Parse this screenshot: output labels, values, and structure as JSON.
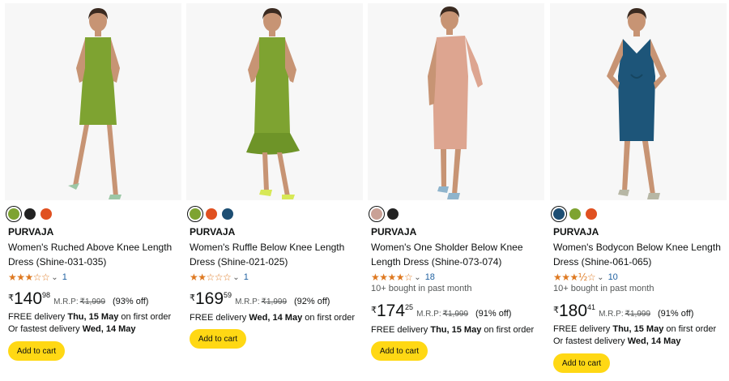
{
  "colors": {
    "star": "#de7921",
    "link": "#2162a1",
    "cart_button": "#ffd814",
    "card_bg": "#f7f7f7"
  },
  "products": [
    {
      "image": "woman-in-green-ruched-dress",
      "dress_color": "#7ea331",
      "swatches": [
        "#7ea331",
        "#222222",
        "#e05020"
      ],
      "brand": "PURVAJA",
      "title": "Women's Ruched Above Knee Length Dress (Shine-031-035)",
      "stars": "★★★☆☆",
      "rating_count": "1",
      "bought": "",
      "currency": "₹",
      "price_whole": "140",
      "price_fraction": "98",
      "mrp_label": "M.R.P:",
      "mrp": "₹1,999",
      "discount": "(93% off)",
      "delivery_prefix": "FREE delivery ",
      "delivery_date": "Thu, 15 May",
      "delivery_suffix": " on first order",
      "fastest_prefix": "Or fastest delivery ",
      "fastest_date": "Wed, 14 May",
      "cart_label": "Add to cart"
    },
    {
      "image": "woman-in-green-ruffle-dress",
      "dress_color": "#7ea331",
      "swatches": [
        "#7ea331",
        "#e05020",
        "#1d4e73"
      ],
      "brand": "PURVAJA",
      "title": "Women's Ruffle Below Knee Length Dress (Shine-021-025)",
      "stars": "★★☆☆☆",
      "rating_count": "1",
      "bought": "",
      "currency": "₹",
      "price_whole": "169",
      "price_fraction": "59",
      "mrp_label": "M.R.P:",
      "mrp": "₹1,999",
      "discount": "(92% off)",
      "delivery_prefix": "FREE delivery ",
      "delivery_date": "Wed, 14 May",
      "delivery_suffix": " on first order",
      "fastest_prefix": "",
      "fastest_date": "",
      "cart_label": "Add to cart"
    },
    {
      "image": "woman-in-peach-one-shoulder-dress",
      "dress_color": "#dda590",
      "swatches": [
        "#c9a196",
        "#222222"
      ],
      "brand": "PURVAJA",
      "title": "Women's One Sholder Below Knee Length Dress (Shine-073-074)",
      "stars": "★★★★☆",
      "rating_count": "18",
      "bought": "10+ bought in past month",
      "currency": "₹",
      "price_whole": "174",
      "price_fraction": "25",
      "mrp_label": "M.R.P:",
      "mrp": "₹1,999",
      "discount": "(91% off)",
      "delivery_prefix": "FREE delivery ",
      "delivery_date": "Thu, 15 May",
      "delivery_suffix": " on first order",
      "fastest_prefix": "",
      "fastest_date": "",
      "cart_label": "Add to cart"
    },
    {
      "image": "woman-in-teal-bodycon-dress",
      "dress_color": "#1d5579",
      "swatches": [
        "#1d4e73",
        "#7ea331",
        "#e05020"
      ],
      "brand": "PURVAJA",
      "title": "Women's Bodycon Below Knee Length Dress (Shine-061-065)",
      "stars": "★★★½☆",
      "rating_count": "10",
      "bought": "10+ bought in past month",
      "currency": "₹",
      "price_whole": "180",
      "price_fraction": "41",
      "mrp_label": "M.R.P:",
      "mrp": "₹1,999",
      "discount": "(91% off)",
      "delivery_prefix": "FREE delivery ",
      "delivery_date": "Thu, 15 May",
      "delivery_suffix": " on first order",
      "fastest_prefix": "Or fastest delivery ",
      "fastest_date": "Wed, 14 May",
      "cart_label": "Add to cart"
    }
  ]
}
